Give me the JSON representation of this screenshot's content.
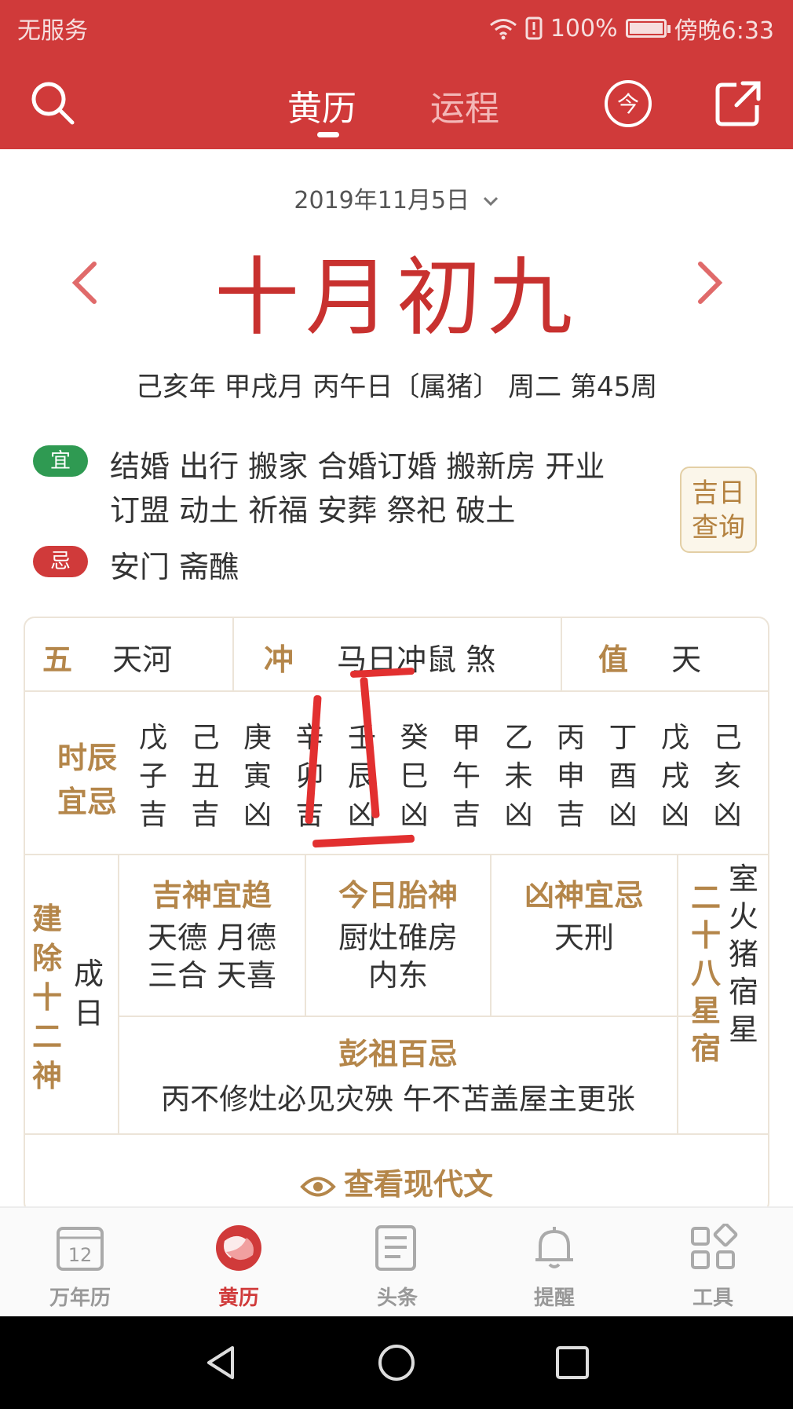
{
  "status_bar": {
    "carrier": "无服务",
    "battery": "100%",
    "battery_level": 1.0,
    "time": "傍晚6:33"
  },
  "header": {
    "tabs": [
      {
        "label": "黄历",
        "active": true
      },
      {
        "label": "运程",
        "active": false
      }
    ],
    "today_icon": "今"
  },
  "date": {
    "selected": "2019年11月5日",
    "lunar": "十月初九",
    "ganzhi": "己亥年 甲戌月 丙午日〔属猪〕 周二 第45周"
  },
  "yi": {
    "badge": "宜",
    "line1": "结婚 出行 搬家 合婚订婚 搬新房 开业",
    "line2": "订盟 动土 祈福 安葬 祭祀 破土"
  },
  "ji": {
    "badge": "忌",
    "line1": "安门  斋醮"
  },
  "jiri_button": {
    "line1": "吉日",
    "line2": "查询"
  },
  "table": {
    "wuxing": {
      "label": "五",
      "value": "天河"
    },
    "chong": {
      "label": "冲",
      "value": "马日冲鼠 煞"
    },
    "zhi": {
      "label": "值",
      "value": "天"
    },
    "shichen": {
      "label1": "时辰",
      "label2": "宜忌",
      "hours": [
        {
          "gan": "戊",
          "zhi": "子",
          "luck": "吉"
        },
        {
          "gan": "己",
          "zhi": "丑",
          "luck": "吉"
        },
        {
          "gan": "庚",
          "zhi": "寅",
          "luck": "凶"
        },
        {
          "gan": "辛",
          "zhi": "卯",
          "luck": "吉"
        },
        {
          "gan": "壬",
          "zhi": "辰",
          "luck": "凶"
        },
        {
          "gan": "癸",
          "zhi": "巳",
          "luck": "凶"
        },
        {
          "gan": "甲",
          "zhi": "午",
          "luck": "吉"
        },
        {
          "gan": "乙",
          "zhi": "未",
          "luck": "凶"
        },
        {
          "gan": "丙",
          "zhi": "申",
          "luck": "吉"
        },
        {
          "gan": "丁",
          "zhi": "酉",
          "luck": "凶"
        },
        {
          "gan": "戊",
          "zhi": "戌",
          "luck": "凶"
        },
        {
          "gan": "己",
          "zhi": "亥",
          "luck": "凶"
        }
      ]
    },
    "jianchu": {
      "label": [
        "建",
        "除",
        "十",
        "二",
        "神"
      ],
      "value": [
        "成",
        "日"
      ]
    },
    "jishen": {
      "title": "吉神宜趋",
      "line1": "天德 月德",
      "line2": "三合 天喜"
    },
    "taishen": {
      "title": "今日胎神",
      "line1": "厨灶碓房",
      "line2": "内东"
    },
    "xiongshen": {
      "title": "凶神宜忌",
      "line1": "天刑"
    },
    "xingxiu": {
      "label": [
        "二",
        "十",
        "八",
        "星",
        "宿"
      ],
      "value": [
        "室",
        "火",
        "猪",
        "宿",
        "星"
      ]
    },
    "pengzu": {
      "title": "彭祖百忌",
      "body": "丙不修灶必见灾殃 午不苫盖屋主更张"
    },
    "modern": "查看现代文"
  },
  "bottom_nav": [
    {
      "label": "万年历",
      "icon": "calendar-icon",
      "badge": "12"
    },
    {
      "label": "黄历",
      "icon": "huangli-logo-icon",
      "active": true
    },
    {
      "label": "头条",
      "icon": "news-icon"
    },
    {
      "label": "提醒",
      "icon": "bell-icon"
    },
    {
      "label": "工具",
      "icon": "tools-icon"
    }
  ]
}
